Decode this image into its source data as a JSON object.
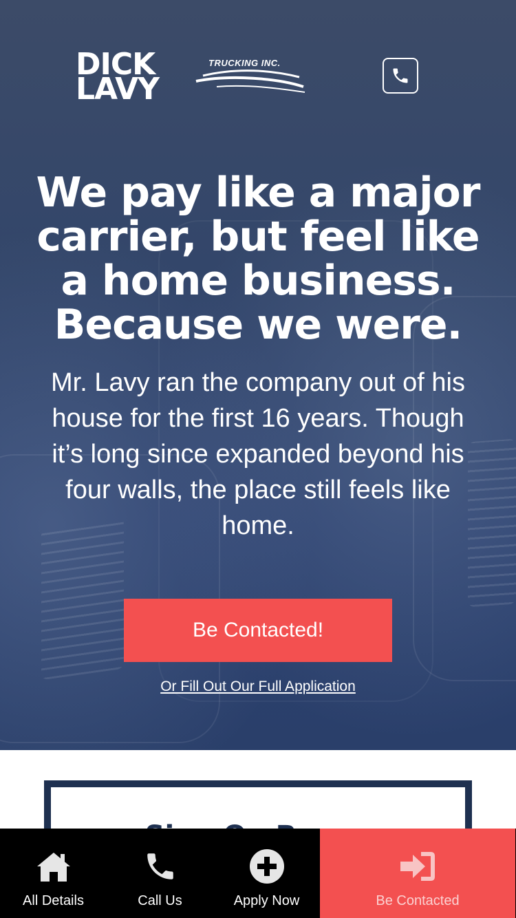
{
  "brand": {
    "line1": "DICK",
    "line2": "LAVY",
    "tagline": "TRUCKING INC."
  },
  "hero": {
    "headline": "We pay like a major carrier, but feel like a home business. Because we were.",
    "body": "Mr. Lavy ran the company out of his house for the first 16 years. Though it’s long since expanded beyond his four walls, the place still feels like home.",
    "cta_label": "Be Contacted!",
    "link_label": "Or Fill Out Our Full Application"
  },
  "card": {
    "title": "Sign On Bonus"
  },
  "nav": {
    "items": [
      {
        "label": "All Details",
        "icon": "home-icon"
      },
      {
        "label": "Call Us",
        "icon": "phone-icon"
      },
      {
        "label": "Apply Now",
        "icon": "plus-circle-icon"
      },
      {
        "label": "Be Contacted",
        "icon": "sign-in-icon"
      }
    ]
  },
  "colors": {
    "accent": "#f35050",
    "navy": "#1e3050",
    "hero_bg": "#33466a",
    "nav_bg": "#000000"
  }
}
